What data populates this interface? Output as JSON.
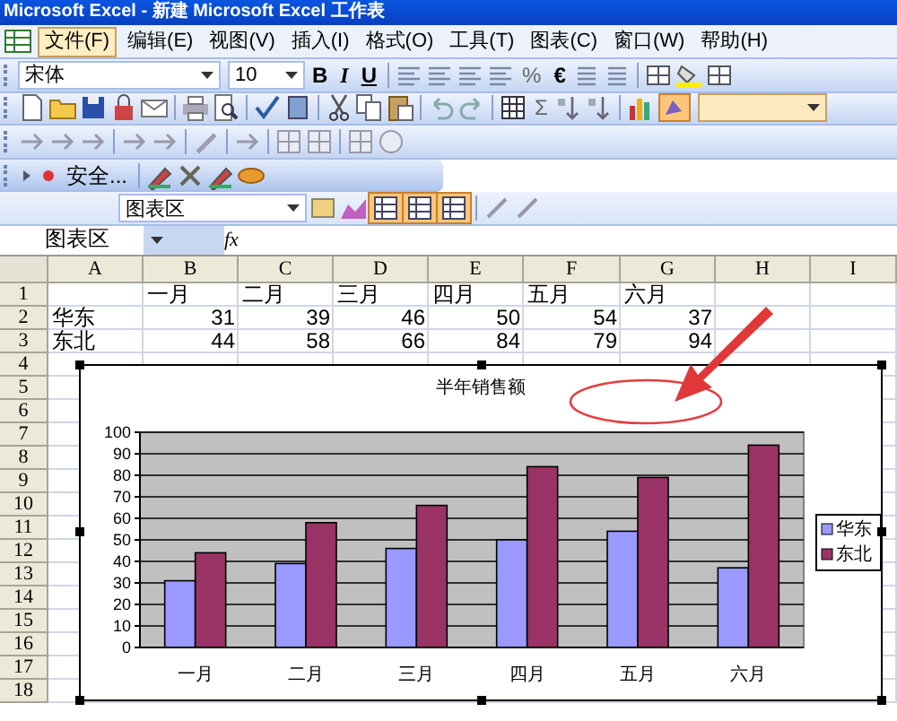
{
  "window": {
    "title": "Microsoft Excel - 新建 Microsoft Excel 工作表"
  },
  "menu": [
    {
      "label": "文件(F)",
      "selected": true
    },
    {
      "label": "编辑(E)",
      "selected": false
    },
    {
      "label": "视图(V)",
      "selected": false
    },
    {
      "label": "插入(I)",
      "selected": false
    },
    {
      "label": "格式(O)",
      "selected": false
    },
    {
      "label": "工具(T)",
      "selected": false
    },
    {
      "label": "图表(C)",
      "selected": false
    },
    {
      "label": "窗口(W)",
      "selected": false
    },
    {
      "label": "帮助(H)",
      "selected": false
    }
  ],
  "format_toolbar": {
    "font": "宋体",
    "size": "10",
    "bold": "B",
    "italic": "I",
    "underline": "U",
    "percent": "%",
    "euro": "€"
  },
  "standard_toolbar": {
    "sum": "Σ"
  },
  "security_toolbar": {
    "security": "安全..."
  },
  "chart_toolbar": {
    "chart_object": "图表区"
  },
  "formula_bar": {
    "name_box": "图表区",
    "fx": "fx"
  },
  "sheet": {
    "columns": [
      "A",
      "B",
      "C",
      "D",
      "E",
      "F",
      "G",
      "H",
      "I"
    ],
    "row_numbers": [
      "1",
      "2",
      "3",
      "4",
      "5",
      "6",
      "7",
      "8",
      "9",
      "10",
      "11",
      "12",
      "13",
      "14",
      "15",
      "16",
      "17",
      "18"
    ],
    "rows": [
      [
        "",
        "一月",
        "二月",
        "三月",
        "四月",
        "五月",
        "六月"
      ],
      [
        "华东",
        "31",
        "39",
        "46",
        "50",
        "54",
        "37"
      ],
      [
        "东北",
        "44",
        "58",
        "66",
        "84",
        "79",
        "94"
      ]
    ]
  },
  "chart": {
    "chart_data": {
      "type": "bar",
      "title": "半年销售额",
      "categories": [
        "一月",
        "二月",
        "三月",
        "四月",
        "五月",
        "六月"
      ],
      "series": [
        {
          "name": "华东",
          "color": "#9999ff",
          "values": [
            31,
            39,
            46,
            50,
            54,
            37
          ]
        },
        {
          "name": "东北",
          "color": "#993366",
          "values": [
            44,
            58,
            66,
            84,
            79,
            94
          ]
        }
      ],
      "grid": true,
      "legend": true,
      "ylim": [
        0,
        100
      ],
      "yticks": [
        0,
        10,
        20,
        30,
        40,
        50,
        60,
        70,
        80,
        90,
        100
      ]
    }
  }
}
